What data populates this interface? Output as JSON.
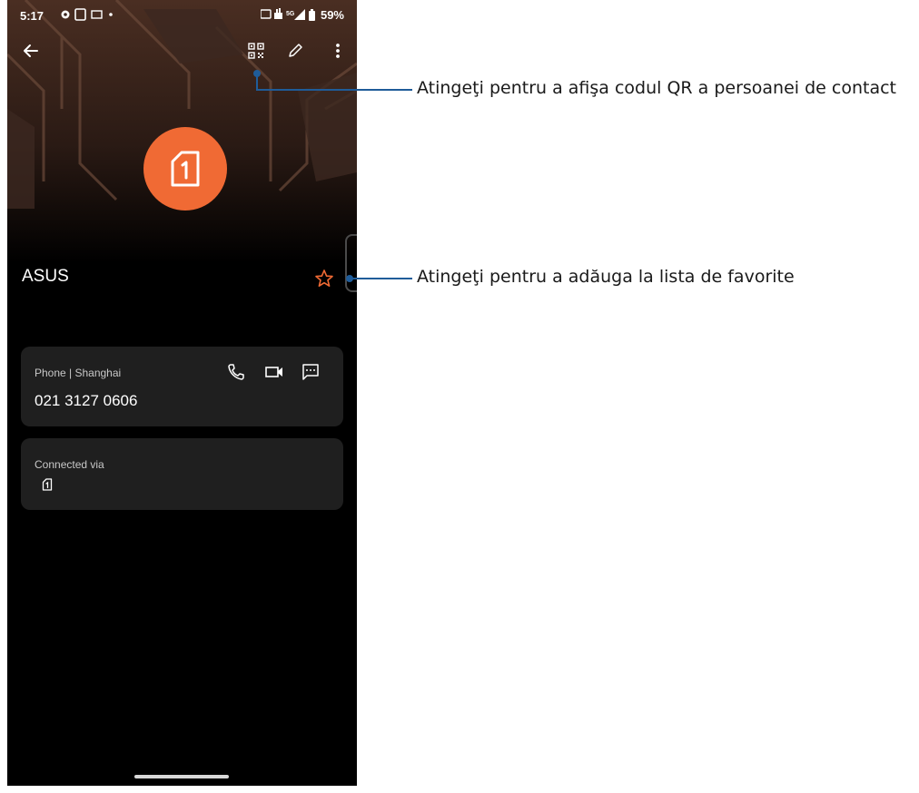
{
  "status_bar": {
    "time": "5:17",
    "battery": "59%",
    "network": "5G",
    "icons": [
      "settings-icon",
      "screenshot-icon",
      "mail-icon",
      "dot-icon",
      "wifi-calling-icon",
      "data-icon",
      "signal-icon",
      "battery-icon"
    ]
  },
  "toolbar": {
    "back_icon": "arrow-left-icon",
    "qr_icon": "qr-code-icon",
    "edit_icon": "pencil-icon",
    "more_icon": "more-vert-icon"
  },
  "contact": {
    "name": "ASUS",
    "avatar_icon": "sim-1-icon",
    "favorite_icon": "star-outline-icon"
  },
  "phone_card": {
    "label": "Phone | Shanghai",
    "number": "021 3127 0606",
    "actions": [
      "phone-icon",
      "video-call-icon",
      "message-icon"
    ]
  },
  "connected_card": {
    "label": "Connected via",
    "icon": "sim-1-icon"
  },
  "callouts": {
    "qr": "Atingeţi pentru a afişa codul QR a persoanei de contact",
    "favorite": "Atingeţi pentru a adăuga la lista de favorite"
  },
  "colors": {
    "accent": "#f06a34",
    "callout": "#1f5c99",
    "card": "#1f1f1f",
    "background": "#000000"
  }
}
